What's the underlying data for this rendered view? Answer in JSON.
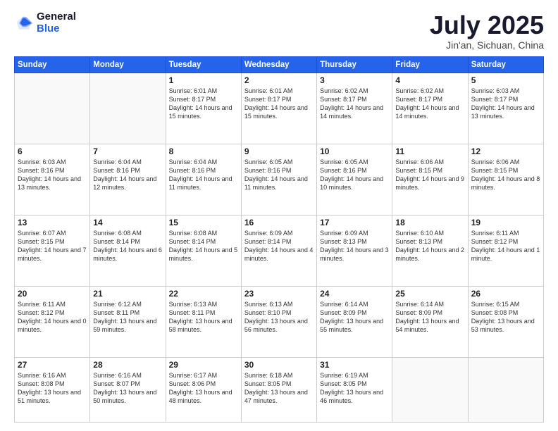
{
  "header": {
    "logo_general": "General",
    "logo_blue": "Blue",
    "month_title": "July 2025",
    "location": "Jin'an, Sichuan, China"
  },
  "weekdays": [
    "Sunday",
    "Monday",
    "Tuesday",
    "Wednesday",
    "Thursday",
    "Friday",
    "Saturday"
  ],
  "weeks": [
    [
      {
        "day": "",
        "info": ""
      },
      {
        "day": "",
        "info": ""
      },
      {
        "day": "1",
        "info": "Sunrise: 6:01 AM\nSunset: 8:17 PM\nDaylight: 14 hours and 15 minutes."
      },
      {
        "day": "2",
        "info": "Sunrise: 6:01 AM\nSunset: 8:17 PM\nDaylight: 14 hours and 15 minutes."
      },
      {
        "day": "3",
        "info": "Sunrise: 6:02 AM\nSunset: 8:17 PM\nDaylight: 14 hours and 14 minutes."
      },
      {
        "day": "4",
        "info": "Sunrise: 6:02 AM\nSunset: 8:17 PM\nDaylight: 14 hours and 14 minutes."
      },
      {
        "day": "5",
        "info": "Sunrise: 6:03 AM\nSunset: 8:17 PM\nDaylight: 14 hours and 13 minutes."
      }
    ],
    [
      {
        "day": "6",
        "info": "Sunrise: 6:03 AM\nSunset: 8:16 PM\nDaylight: 14 hours and 13 minutes."
      },
      {
        "day": "7",
        "info": "Sunrise: 6:04 AM\nSunset: 8:16 PM\nDaylight: 14 hours and 12 minutes."
      },
      {
        "day": "8",
        "info": "Sunrise: 6:04 AM\nSunset: 8:16 PM\nDaylight: 14 hours and 11 minutes."
      },
      {
        "day": "9",
        "info": "Sunrise: 6:05 AM\nSunset: 8:16 PM\nDaylight: 14 hours and 11 minutes."
      },
      {
        "day": "10",
        "info": "Sunrise: 6:05 AM\nSunset: 8:16 PM\nDaylight: 14 hours and 10 minutes."
      },
      {
        "day": "11",
        "info": "Sunrise: 6:06 AM\nSunset: 8:15 PM\nDaylight: 14 hours and 9 minutes."
      },
      {
        "day": "12",
        "info": "Sunrise: 6:06 AM\nSunset: 8:15 PM\nDaylight: 14 hours and 8 minutes."
      }
    ],
    [
      {
        "day": "13",
        "info": "Sunrise: 6:07 AM\nSunset: 8:15 PM\nDaylight: 14 hours and 7 minutes."
      },
      {
        "day": "14",
        "info": "Sunrise: 6:08 AM\nSunset: 8:14 PM\nDaylight: 14 hours and 6 minutes."
      },
      {
        "day": "15",
        "info": "Sunrise: 6:08 AM\nSunset: 8:14 PM\nDaylight: 14 hours and 5 minutes."
      },
      {
        "day": "16",
        "info": "Sunrise: 6:09 AM\nSunset: 8:14 PM\nDaylight: 14 hours and 4 minutes."
      },
      {
        "day": "17",
        "info": "Sunrise: 6:09 AM\nSunset: 8:13 PM\nDaylight: 14 hours and 3 minutes."
      },
      {
        "day": "18",
        "info": "Sunrise: 6:10 AM\nSunset: 8:13 PM\nDaylight: 14 hours and 2 minutes."
      },
      {
        "day": "19",
        "info": "Sunrise: 6:11 AM\nSunset: 8:12 PM\nDaylight: 14 hours and 1 minute."
      }
    ],
    [
      {
        "day": "20",
        "info": "Sunrise: 6:11 AM\nSunset: 8:12 PM\nDaylight: 14 hours and 0 minutes."
      },
      {
        "day": "21",
        "info": "Sunrise: 6:12 AM\nSunset: 8:11 PM\nDaylight: 13 hours and 59 minutes."
      },
      {
        "day": "22",
        "info": "Sunrise: 6:13 AM\nSunset: 8:11 PM\nDaylight: 13 hours and 58 minutes."
      },
      {
        "day": "23",
        "info": "Sunrise: 6:13 AM\nSunset: 8:10 PM\nDaylight: 13 hours and 56 minutes."
      },
      {
        "day": "24",
        "info": "Sunrise: 6:14 AM\nSunset: 8:09 PM\nDaylight: 13 hours and 55 minutes."
      },
      {
        "day": "25",
        "info": "Sunrise: 6:14 AM\nSunset: 8:09 PM\nDaylight: 13 hours and 54 minutes."
      },
      {
        "day": "26",
        "info": "Sunrise: 6:15 AM\nSunset: 8:08 PM\nDaylight: 13 hours and 53 minutes."
      }
    ],
    [
      {
        "day": "27",
        "info": "Sunrise: 6:16 AM\nSunset: 8:08 PM\nDaylight: 13 hours and 51 minutes."
      },
      {
        "day": "28",
        "info": "Sunrise: 6:16 AM\nSunset: 8:07 PM\nDaylight: 13 hours and 50 minutes."
      },
      {
        "day": "29",
        "info": "Sunrise: 6:17 AM\nSunset: 8:06 PM\nDaylight: 13 hours and 48 minutes."
      },
      {
        "day": "30",
        "info": "Sunrise: 6:18 AM\nSunset: 8:05 PM\nDaylight: 13 hours and 47 minutes."
      },
      {
        "day": "31",
        "info": "Sunrise: 6:19 AM\nSunset: 8:05 PM\nDaylight: 13 hours and 46 minutes."
      },
      {
        "day": "",
        "info": ""
      },
      {
        "day": "",
        "info": ""
      }
    ]
  ]
}
